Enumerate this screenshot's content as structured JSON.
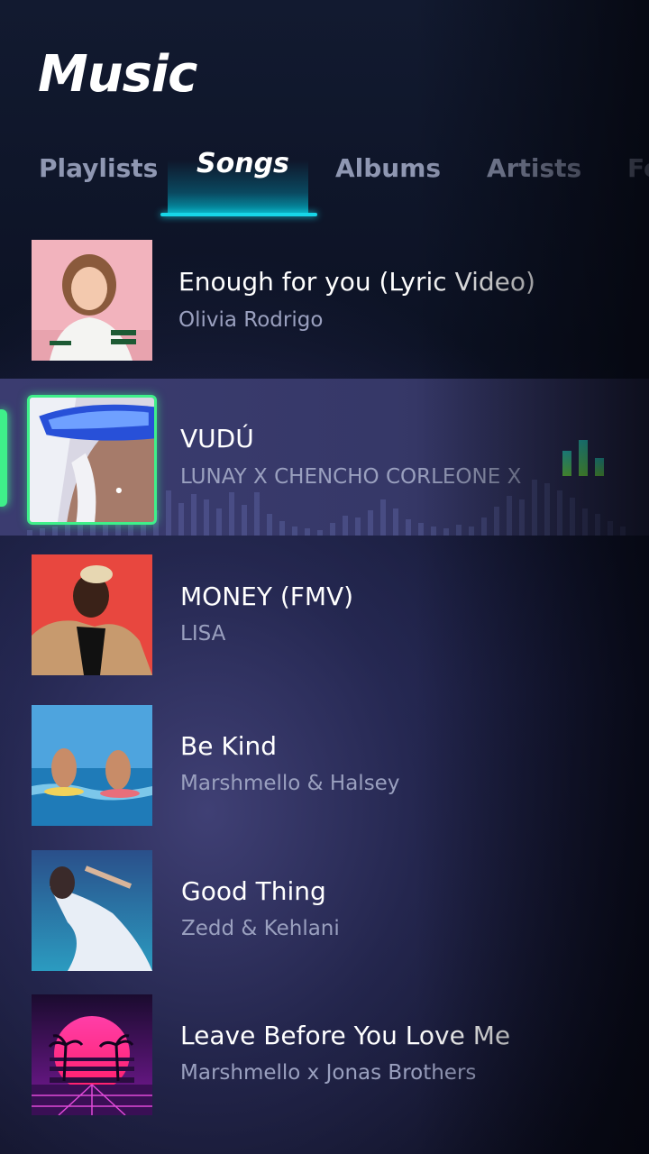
{
  "app": {
    "title": "Music"
  },
  "tabs": [
    {
      "label": "Playlists",
      "active": false
    },
    {
      "label": "Songs",
      "active": true
    },
    {
      "label": "Albums",
      "active": false
    },
    {
      "label": "Artists",
      "active": false
    },
    {
      "label": "Fo",
      "active": false
    }
  ],
  "songs": [
    {
      "title": "Enough for you (Lyric Video)",
      "artist": "Olivia Rodrigo",
      "thumbnail": "portrait-pink-background"
    },
    {
      "title": "VUDÚ",
      "artist": "LUNAY X CHENCHO CORLEONE X",
      "thumbnail": "portrait-blue-visor",
      "selected": true,
      "playing": true,
      "playing_icon": "equalizer-icon"
    },
    {
      "title": "MONEY (FMV)",
      "artist": "LISA",
      "thumbnail": "portrait-red-background"
    },
    {
      "title": "Be Kind",
      "artist": "Marshmello & Halsey",
      "thumbnail": "ocean-surfers"
    },
    {
      "title": "Good Thing",
      "artist": "Zedd & Kehlani",
      "thumbnail": "underwater-dress"
    },
    {
      "title": "Leave Before You Love Me",
      "artist": "Marshmello x Jonas Brothers",
      "thumbnail": "synthwave-sunset"
    }
  ],
  "colors": {
    "accent_tab": "#17d6e8",
    "accent_playing": "#3ff08a",
    "text_primary": "#ffffff",
    "text_secondary": "#9aa0bf"
  }
}
